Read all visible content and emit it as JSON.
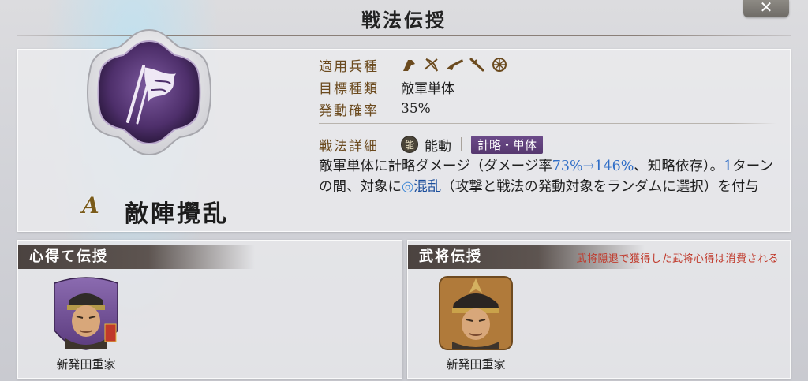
{
  "header": {
    "title": "戦法伝授",
    "close_label": "✕"
  },
  "skill": {
    "grade": "A",
    "name": "敵陣攪乱",
    "troop_label": "適用兵種",
    "troop_icons": [
      "spear-icon",
      "bow-icon",
      "gun-icon",
      "sword-icon",
      "wheel-icon"
    ],
    "target_label": "目標種類",
    "target_value": "敵軍単体",
    "rate_label": "発動確率",
    "rate_value": "35%",
    "detail_label": "戦法詳細",
    "type_badge": "能",
    "type_label": "能動",
    "category_tag": "計略・単体",
    "desc": {
      "p1": "敵軍単体に計略ダメージ（ダメージ率",
      "dmg_rate": "73%→146%",
      "p2": "、知略依存）。",
      "turns": "1",
      "p3": "ターンの間、対象に",
      "status_icon": "swirl-icon",
      "status": "混乱",
      "p4": "（攻撃と戦法の発動対象をランダムに選択）を付与"
    }
  },
  "left_panel": {
    "header": "心得て伝授",
    "officer_name": "新発田重家",
    "badge": "心得"
  },
  "right_panel": {
    "header": "武将伝授",
    "note_p1": "武将",
    "note_link": "隠退",
    "note_p2": "で獲得した武将心得は消費される",
    "officer_name": "新発田重家"
  },
  "colors": {
    "label_brown": "#6b4a1e",
    "tag_purple": "#5e3f7a",
    "rate_blue": "#2f6dc7",
    "note_red": "#c0392b"
  }
}
